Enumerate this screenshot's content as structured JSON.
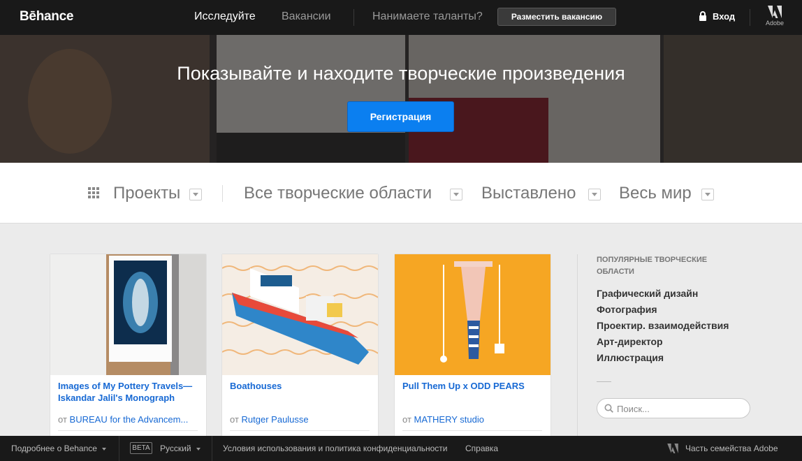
{
  "brand": {
    "logo": "Bēhance"
  },
  "nav": {
    "explore": "Исследуйте",
    "jobs": "Вакансии",
    "hiring_question": "Нанимаете таланты?",
    "post_job": "Разместить вакансию",
    "login": "Вход",
    "adobe": "Adobe"
  },
  "hero": {
    "headline": "Показывайте и находите творческие произведения",
    "signup": "Регистрация"
  },
  "filters": {
    "projects": "Проекты",
    "fields": "Все творческие области",
    "featured": "Выставлено",
    "location": "Весь мир"
  },
  "projects": [
    {
      "title": "Images of My Pottery Travels— Iskandar Jalil's Monograph",
      "by": "от",
      "owner": "BUREAU for the Advancem..."
    },
    {
      "title": "Boathouses",
      "by": "от",
      "owner": "Rutger Paulusse"
    },
    {
      "title": "Pull Them Up x ODD PEARS",
      "by": "от",
      "owner": "MATHERY studio"
    }
  ],
  "sidebar": {
    "heading": "ПОПУЛЯРНЫЕ ТВОРЧЕСКИЕ ОБЛАСТИ",
    "items": [
      "Графический дизайн",
      "Фотография",
      "Проектир. взаимодействия",
      "Арт-директор",
      "Иллюстрация"
    ],
    "search_placeholder": "Поиск..."
  },
  "footer": {
    "about": "Подробнее о Behance",
    "beta": "BETA",
    "language": "Русский",
    "terms": "Условия использования и политика конфиденциальности",
    "help": "Справка",
    "adobe_family": "Часть семейства Adobe"
  },
  "colors": {
    "topbar": "#191919",
    "primary_button": "#0b7ff0",
    "link": "#1769d4",
    "page_bg": "#ebebeb"
  }
}
